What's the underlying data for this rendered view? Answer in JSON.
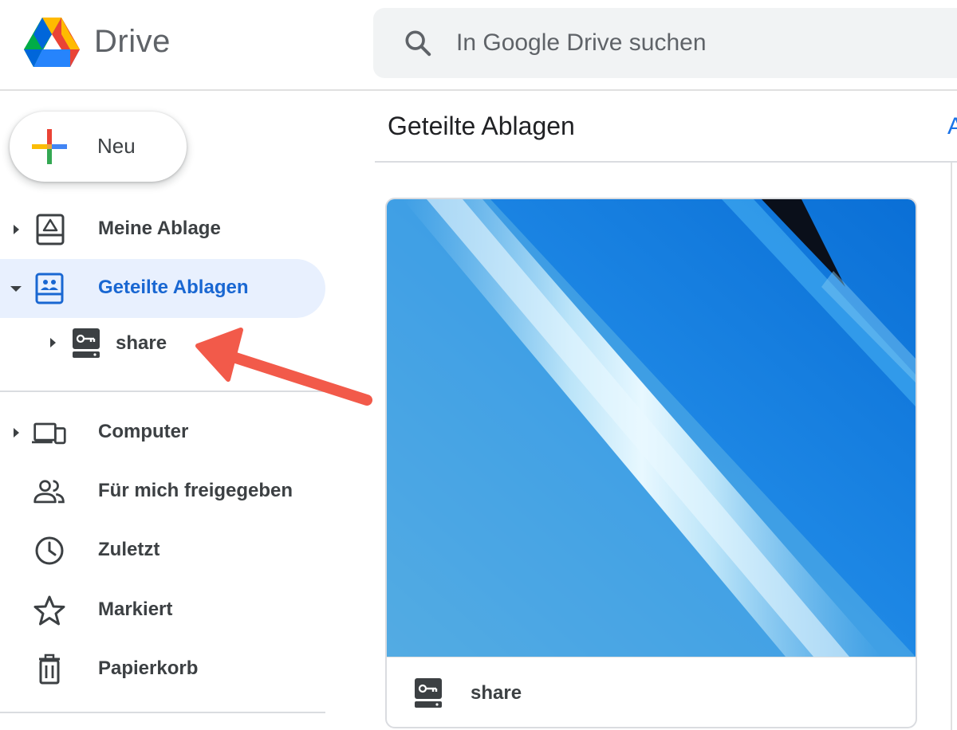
{
  "header": {
    "app_name": "Drive",
    "search_placeholder": "In Google Drive suchen"
  },
  "sidebar": {
    "new_button_label": "Neu",
    "items": [
      {
        "label": "Meine Ablage",
        "icon": "my-drive-icon"
      },
      {
        "label": "Geteilte Ablagen",
        "icon": "shared-drives-icon",
        "active": true
      },
      {
        "label": "Computer",
        "icon": "computer-icon"
      },
      {
        "label": "Für mich freigegeben",
        "icon": "people-icon"
      },
      {
        "label": "Zuletzt",
        "icon": "clock-icon"
      },
      {
        "label": "Markiert",
        "icon": "star-icon"
      },
      {
        "label": "Papierkorb",
        "icon": "trash-icon"
      }
    ],
    "sub_items": [
      {
        "label": "share",
        "icon": "shared-drive-icon"
      }
    ]
  },
  "main": {
    "title": "Geteilte Ablagen",
    "title_right_clipped": "A",
    "cards": [
      {
        "label": "share",
        "icon": "shared-drive-icon"
      }
    ]
  },
  "colors": {
    "active_bg": "#e8f0fe",
    "active_text": "#1967d2",
    "annotation_arrow": "#f25a4a"
  }
}
